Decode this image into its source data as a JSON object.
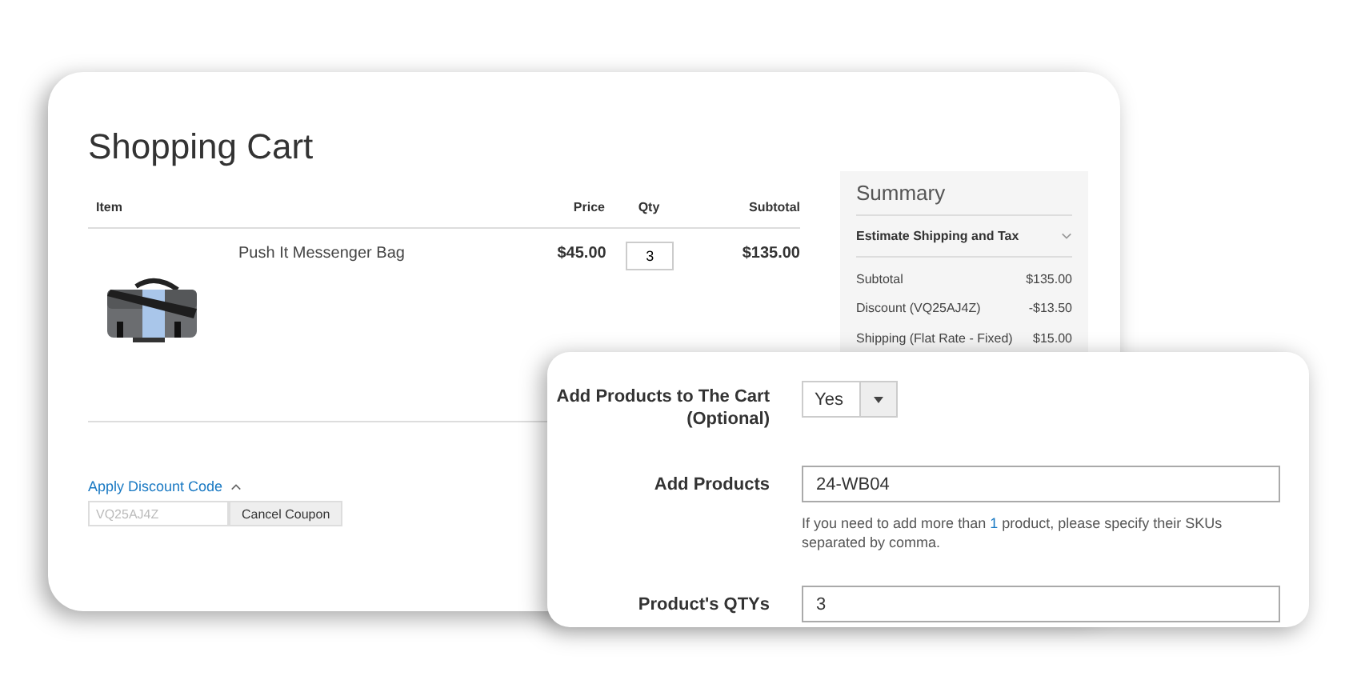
{
  "cart": {
    "title": "Shopping Cart",
    "columns": [
      "Item",
      "Price",
      "Qty",
      "Subtotal"
    ],
    "rows": [
      {
        "name": "Push It Messenger Bag",
        "price": "$45.00",
        "qty": "3",
        "subtotal": "$135.00"
      }
    ],
    "discount": {
      "label": "Apply Discount Code",
      "expanded": true,
      "code": "VQ25AJ4Z",
      "button": "Cancel Coupon"
    }
  },
  "summary": {
    "title": "Summary",
    "estimate": "Estimate Shipping and Tax",
    "lines": [
      {
        "label": "Subtotal",
        "value": "$135.00"
      },
      {
        "label": "Discount (VQ25AJ4Z)",
        "value": "-$13.50"
      },
      {
        "label": "Shipping (Flat Rate - Fixed)",
        "value": "$15.00"
      }
    ]
  },
  "settings": {
    "add_to_cart": {
      "label": "Add Products to The Cart (Optional)",
      "value": "Yes"
    },
    "products": {
      "label": "Add Products",
      "value": "24-WB04",
      "hint": [
        {
          "kind": "text",
          "text": "If you need to add more than "
        },
        {
          "kind": "number",
          "text": "1"
        },
        {
          "kind": "text",
          "text": " product, please specify their SKUs separated by comma."
        }
      ]
    },
    "qtys": {
      "label": "Product's QTYs",
      "value": "3"
    }
  }
}
